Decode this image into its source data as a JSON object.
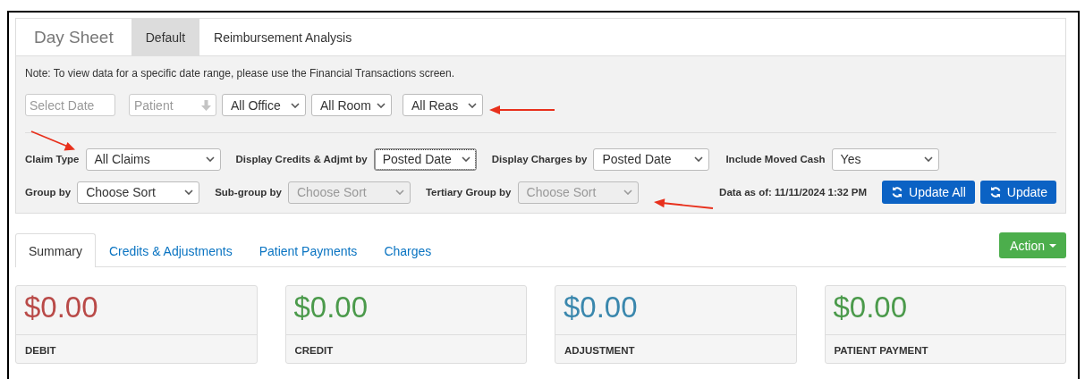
{
  "header": {
    "title": "Day Sheet",
    "tabs": [
      {
        "label": "Default",
        "selected": true
      },
      {
        "label": "Reimbursement Analysis",
        "selected": false
      }
    ]
  },
  "filters": {
    "note": "Note: To view data for a specific date range, please use the Financial Transactions screen.",
    "top_row": [
      {
        "kind": "input",
        "placeholder": "Select Date"
      },
      {
        "kind": "lookup",
        "placeholder": "Patient"
      },
      {
        "kind": "select",
        "value": "All Office"
      },
      {
        "kind": "select",
        "value": "All Room"
      },
      {
        "kind": "select",
        "value": "All Reas"
      }
    ],
    "row_2": [
      {
        "label": "Claim Type",
        "value": "All Claims",
        "disabled": false,
        "focused": false
      },
      {
        "label": "Display Credits & Adjmt by",
        "value": "Posted Date",
        "disabled": false,
        "focused": true
      },
      {
        "label": "Display Charges by",
        "value": "Posted Date",
        "disabled": false,
        "focused": false
      },
      {
        "label": "Include Moved Cash",
        "value": "Yes",
        "disabled": false,
        "focused": false
      }
    ],
    "row_3": [
      {
        "label": "Group by",
        "value": "Choose Sort",
        "disabled": false,
        "focused": false
      },
      {
        "label": "Sub-group by",
        "value": "Choose Sort",
        "disabled": true,
        "focused": false
      },
      {
        "label": "Tertiary Group by",
        "value": "Choose Sort",
        "disabled": true,
        "focused": false
      }
    ],
    "data_as_of": "Data as of: 11/11/2024 1:32 PM",
    "buttons": [
      "Update All",
      "Update"
    ]
  },
  "results": {
    "tabs": [
      {
        "label": "Summary",
        "selected": true
      },
      {
        "label": "Credits & Adjustments",
        "selected": false
      },
      {
        "label": "Patient Payments",
        "selected": false
      },
      {
        "label": "Charges",
        "selected": false
      }
    ],
    "action_button": "Action",
    "cards": [
      {
        "amount": "$0.00",
        "label": "DEBIT",
        "color": "#b94a48"
      },
      {
        "amount": "$0.00",
        "label": "CREDIT",
        "color": "#4b9a4b"
      },
      {
        "amount": "$0.00",
        "label": "ADJUSTMENT",
        "color": "#3a87ad"
      },
      {
        "amount": "$0.00",
        "label": "PATIENT PAYMENT",
        "color": "#4b9a4b"
      }
    ]
  },
  "annotations": [
    {
      "kind": "arrow"
    },
    {
      "kind": "arrow"
    },
    {
      "kind": "arrow"
    }
  ]
}
